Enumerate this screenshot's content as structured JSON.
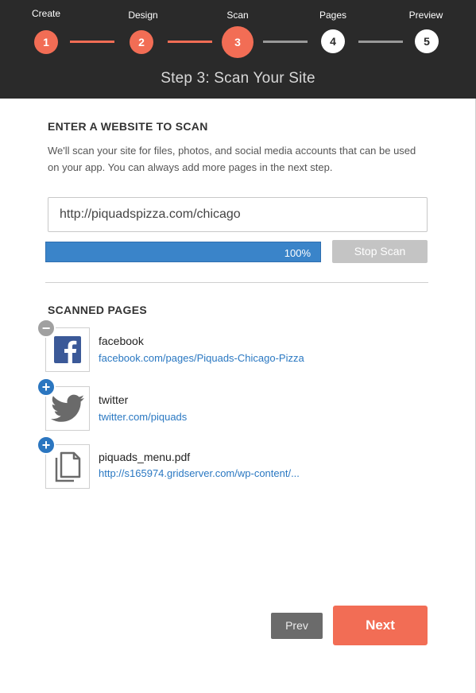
{
  "wizard": {
    "steps": [
      {
        "number": "1",
        "label": "Create",
        "state": "done"
      },
      {
        "number": "2",
        "label": "Design",
        "state": "done"
      },
      {
        "number": "3",
        "label": "Scan",
        "state": "active"
      },
      {
        "number": "4",
        "label": "Pages",
        "state": "todo"
      },
      {
        "number": "5",
        "label": "Preview",
        "state": "todo"
      }
    ],
    "title": "Step 3: Scan Your Site",
    "colors": {
      "header_bg": "#2a2a2a",
      "accent": "#f26d55",
      "inactive_line": "#999999"
    }
  },
  "scan": {
    "heading": "ENTER A WEBSITE TO SCAN",
    "description": "We'll scan your site for files, photos, and social media accounts that can be used on your app.  You can always add more pages in the next step.",
    "url_value": "http://piquadspizza.com/chicago",
    "progress": 1.0,
    "progress_label": "100%",
    "stop_label": "Stop Scan",
    "progress_color": "#3a84c9"
  },
  "scanned": {
    "heading": "SCANNED PAGES",
    "items": [
      {
        "name": "facebook",
        "link": "facebook.com/pages/Piquads-Chicago-Pizza",
        "icon": "facebook-icon",
        "action": "remove",
        "action_symbol": "−"
      },
      {
        "name": "twitter",
        "link": "twitter.com/piquads",
        "icon": "twitter-icon",
        "action": "add",
        "action_symbol": "+"
      },
      {
        "name": "piquads_menu.pdf",
        "link": "http://s165974.gridserver.com/wp-content/...",
        "icon": "document-icon",
        "action": "add",
        "action_symbol": "+"
      }
    ]
  },
  "nav": {
    "prev_label": "Prev",
    "next_label": "Next"
  }
}
